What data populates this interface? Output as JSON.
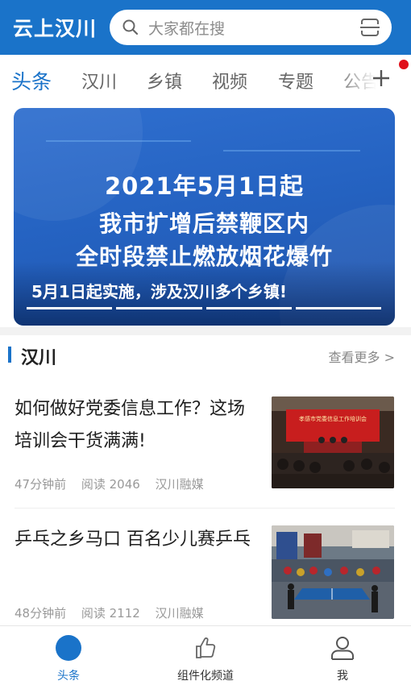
{
  "header": {
    "app_title": "云上汉川",
    "search_placeholder": "大家都在搜"
  },
  "tabs": [
    {
      "label": "头条",
      "active": true
    },
    {
      "label": "汉川",
      "active": false
    },
    {
      "label": "乡镇",
      "active": false
    },
    {
      "label": "视频",
      "active": false
    },
    {
      "label": "专题",
      "active": false
    },
    {
      "label": "公告",
      "active": false
    }
  ],
  "banner": {
    "line1": "2021年5月1日起",
    "line2": "我市扩增后禁鞭区内",
    "line3": "全时段禁止燃放烟花爆竹",
    "caption": "5月1日起实施，涉及汉川多个乡镇!",
    "slide_count": 4,
    "current_slide": 4
  },
  "section": {
    "title": "汉川",
    "more_label": "查看更多 >"
  },
  "news": [
    {
      "title": "如何做好党委信息工作？这场培训会干货满满!",
      "time": "47分钟前",
      "reads": "阅读 2046",
      "source": "汉川融媒",
      "thumb_banner": "孝感市党委信息工作培训会"
    },
    {
      "title": "乒乓之乡马口 百名少儿赛乒乓",
      "time": "48分钟前",
      "reads": "阅读 2112",
      "source": "汉川融媒"
    }
  ],
  "bottom_nav": [
    {
      "label": "头条",
      "icon": "circle-home-icon",
      "active": true
    },
    {
      "label": "组件化频道",
      "icon": "thumbs-up-icon",
      "active": false
    },
    {
      "label": "我",
      "icon": "user-icon",
      "active": false
    }
  ],
  "colors": {
    "brand_blue": "#1a73c9",
    "badge_red": "#e0101b"
  }
}
